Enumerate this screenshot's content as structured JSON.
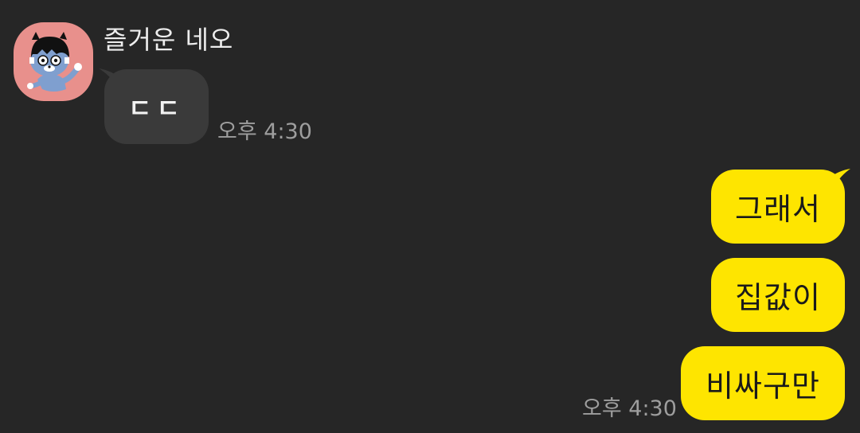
{
  "conversation": {
    "incoming": {
      "sender_name": "즐거운 네오",
      "avatar_icon": "kakao-neo-character-icon",
      "avatar_bg": "#e8908c",
      "message": "ㄷㄷ",
      "time": "오후 4:30"
    },
    "outgoing": {
      "messages": [
        "그래서",
        "집값이",
        "비싸구만"
      ],
      "time": "오후 4:30"
    }
  },
  "colors": {
    "background": "#262626",
    "incoming_bubble": "#3a3a3a",
    "outgoing_bubble": "#fee500",
    "timestamp": "#9e9e9e"
  }
}
